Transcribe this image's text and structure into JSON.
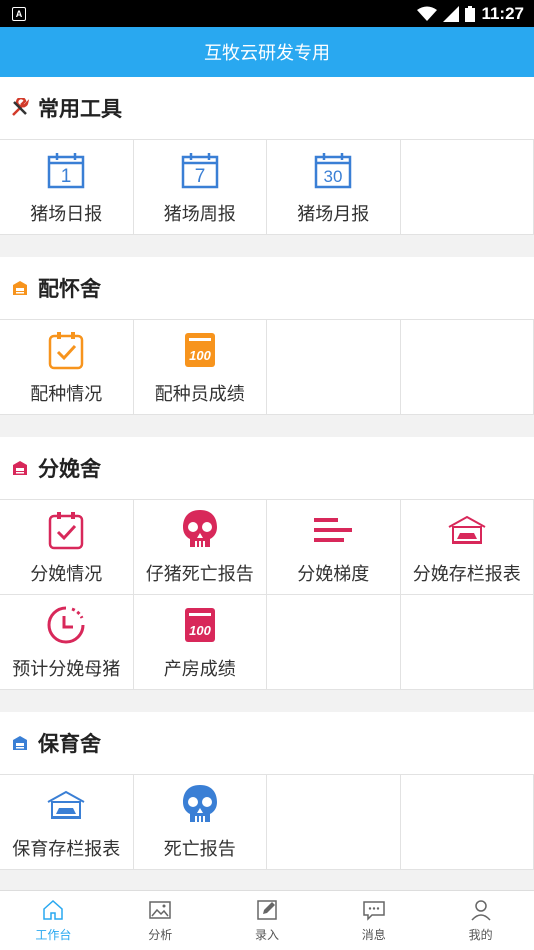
{
  "status": {
    "time": "11:27"
  },
  "title": "互牧云研发专用",
  "sections": [
    {
      "title": "常用工具",
      "icon": "wrench-icon",
      "items": [
        {
          "label": "猪场日报",
          "icon": "calendar-1-icon",
          "num": "1"
        },
        {
          "label": "猪场周报",
          "icon": "calendar-7-icon",
          "num": "7"
        },
        {
          "label": "猪场月报",
          "icon": "calendar-30-icon",
          "num": "30"
        }
      ]
    },
    {
      "title": "配怀舍",
      "icon": "barn-icon",
      "items": [
        {
          "label": "配种情况",
          "icon": "clipboard-check-icon"
        },
        {
          "label": "配种员成绩",
          "icon": "score-100-icon"
        }
      ]
    },
    {
      "title": "分娩舍",
      "icon": "barn-icon",
      "items": [
        {
          "label": "分娩情况",
          "icon": "clipboard-check-icon"
        },
        {
          "label": "仔猪死亡报告",
          "icon": "skull-icon"
        },
        {
          "label": "分娩梯度",
          "icon": "bars-icon"
        },
        {
          "label": "分娩存栏报表",
          "icon": "garage-icon"
        },
        {
          "label": "预计分娩母猪",
          "icon": "clock-icon"
        },
        {
          "label": "产房成绩",
          "icon": "score-100-icon"
        }
      ]
    },
    {
      "title": "保育舍",
      "icon": "barn-icon",
      "items": [
        {
          "label": "保育存栏报表",
          "icon": "garage-icon"
        },
        {
          "label": "死亡报告",
          "icon": "skull-icon"
        }
      ]
    }
  ],
  "colors": {
    "blue": "#29a8f0",
    "red": "#d8285a",
    "orange": "#f7941d",
    "iconblue": "#3a7fd5"
  },
  "tabs": [
    {
      "label": "工作台",
      "icon": "home-icon"
    },
    {
      "label": "分析",
      "icon": "image-icon"
    },
    {
      "label": "录入",
      "icon": "edit-icon"
    },
    {
      "label": "消息",
      "icon": "message-icon"
    },
    {
      "label": "我的",
      "icon": "user-icon"
    }
  ]
}
